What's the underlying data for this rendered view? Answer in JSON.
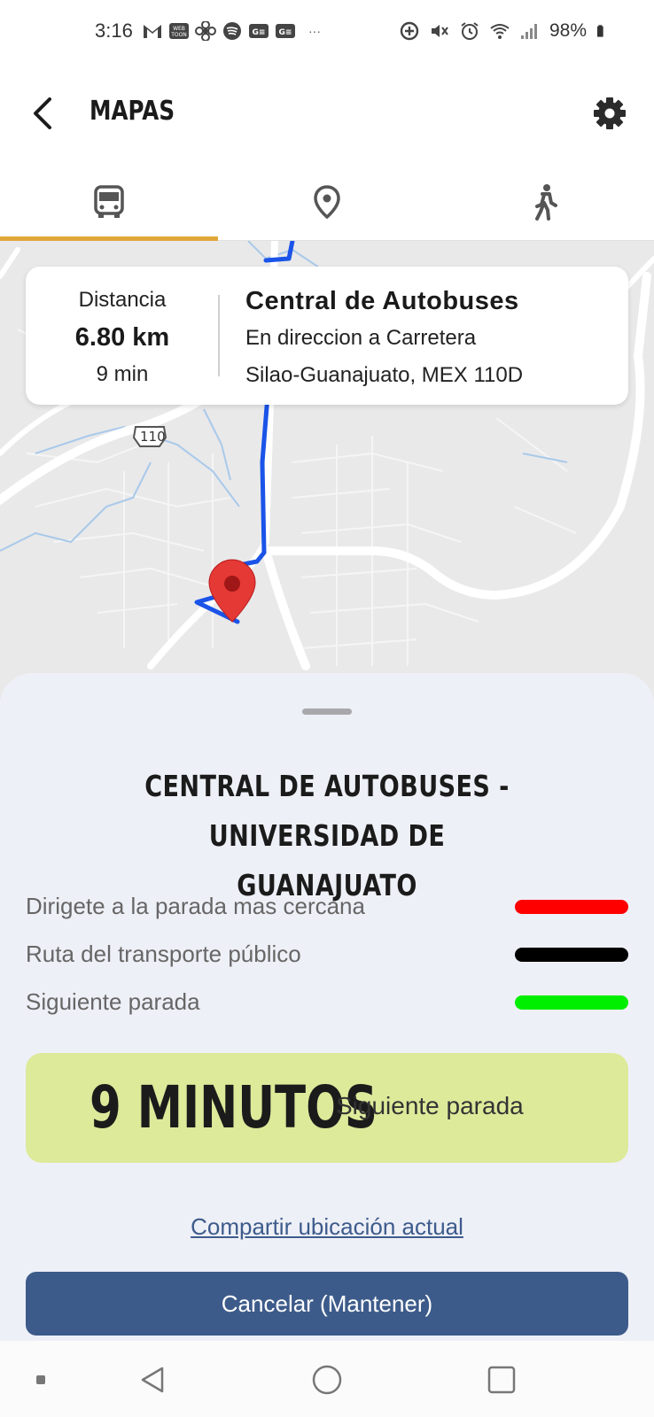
{
  "status_bar": {
    "time": "3:16",
    "battery_text": "98%",
    "icons_left": [
      "gmail-icon",
      "webtoon-icon",
      "pinwheel-icon",
      "spotify-icon",
      "news-icon",
      "news-icon",
      "more-icon"
    ],
    "icons_right": [
      "data-saver-icon",
      "mute-icon",
      "alarm-icon",
      "wifi-icon",
      "signal-icon",
      "battery-icon"
    ]
  },
  "header": {
    "title": "MAPAS"
  },
  "tabs": [
    {
      "icon": "bus-icon",
      "active": true
    },
    {
      "icon": "location-pin-icon",
      "active": false
    },
    {
      "icon": "walking-icon",
      "active": false
    }
  ],
  "tab_indicator_color": "#e0a73a",
  "map": {
    "road_shield": "110",
    "route_color": "#1a53e8",
    "marker_color": "#e53935"
  },
  "info_card": {
    "distance_label": "Distancia",
    "distance_value": "6.80 km",
    "time": "9 min",
    "destination": "Central de Autobuses",
    "direction_line1": "En direccion a Carretera",
    "direction_line2": "Silao-Guanajuato, MEX 110D"
  },
  "sheet": {
    "route_title_line1": "CENTRAL DE AUTOBUSES - UNIVERSIDAD DE",
    "route_title_line2": "GUANAJUATO",
    "legend": [
      {
        "label": "Dirigete a la parada mas cercana",
        "color": "#ff0000"
      },
      {
        "label": "Ruta del transporte público",
        "color": "#000000"
      },
      {
        "label": "Siguiente parada",
        "color": "#00ee00"
      }
    ],
    "eta_minutes": "9 MINUTOS",
    "eta_label": "Siguiente parada",
    "share_link": "Compartir ubicación actual",
    "cancel_button": "Cancelar (Mantener)"
  },
  "nav_bar": {
    "items": [
      "recents-dot-icon",
      "back-triangle-icon",
      "home-circle-icon",
      "overview-square-icon"
    ]
  }
}
